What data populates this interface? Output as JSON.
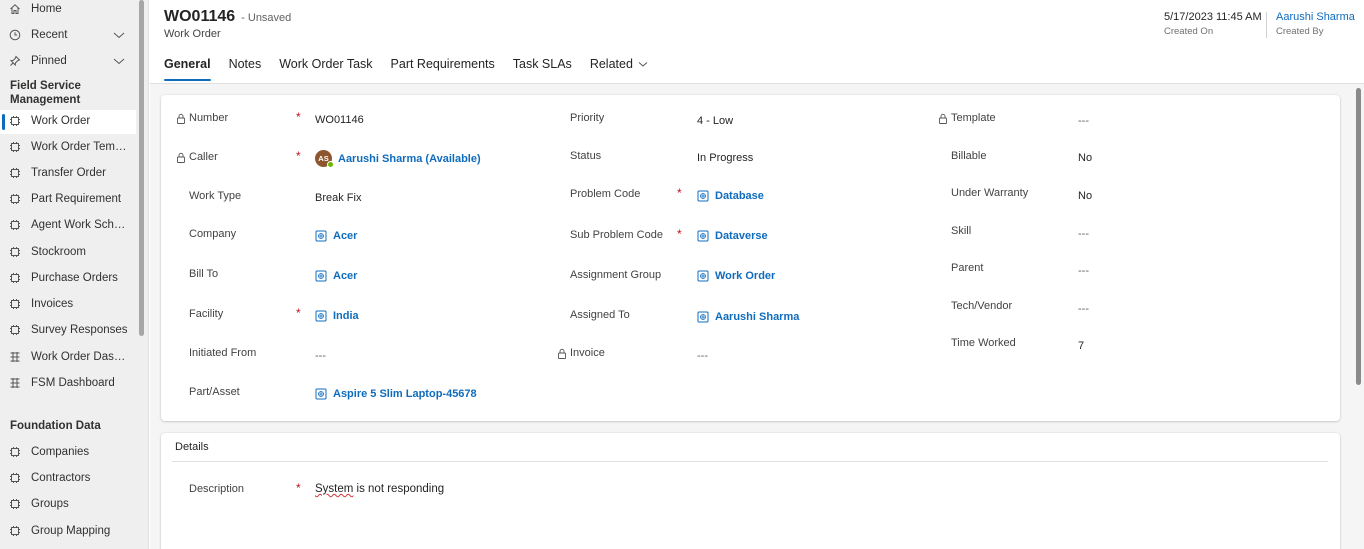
{
  "sidebar": {
    "top_items": [
      {
        "label": "Home",
        "icon": "home-icon"
      },
      {
        "label": "Recent",
        "icon": "clock-icon"
      },
      {
        "label": "Pinned",
        "icon": "pin-icon"
      }
    ],
    "group1_title": "Field Service Management",
    "group1_items": [
      {
        "label": "Work Order"
      },
      {
        "label": "Work Order Templ..."
      },
      {
        "label": "Transfer Order"
      },
      {
        "label": "Part Requirement"
      },
      {
        "label": "Agent Work Sche..."
      },
      {
        "label": "Stockroom"
      },
      {
        "label": "Purchase Orders"
      },
      {
        "label": "Invoices"
      },
      {
        "label": "Survey Responses"
      },
      {
        "label": "Work Order Dash..."
      },
      {
        "label": "FSM Dashboard"
      }
    ],
    "group2_title": "Foundation Data",
    "group2_items": [
      {
        "label": "Companies"
      },
      {
        "label": "Contractors"
      },
      {
        "label": "Groups"
      },
      {
        "label": "Group Mapping"
      }
    ]
  },
  "header": {
    "record_number": "WO01146",
    "status_text": "- Unsaved",
    "entity_name": "Work Order",
    "created_on_value": "5/17/2023 11:45 AM",
    "created_on_label": "Created On",
    "created_by_value": "Aarushi Sharma",
    "created_by_label": "Created By"
  },
  "tabs": [
    "General",
    "Notes",
    "Work Order Task",
    "Part Requirements",
    "Task SLAs",
    "Related"
  ],
  "form": {
    "col1": [
      {
        "label": "Number",
        "value": "WO01146"
      },
      {
        "label": "Caller",
        "value": "Aarushi Sharma (Available)",
        "avatar": "AS"
      },
      {
        "label": "Work Type",
        "value": "Break Fix"
      },
      {
        "label": "Company",
        "value": "Acer"
      },
      {
        "label": "Bill To",
        "value": "Acer"
      },
      {
        "label": "Facility",
        "value": "India"
      },
      {
        "label": "Initiated From",
        "value": "---"
      },
      {
        "label": "Part/Asset",
        "value": "Aspire 5 Slim Laptop-45678"
      }
    ],
    "col2": [
      {
        "label": "Priority",
        "value": "4 - Low"
      },
      {
        "label": "Status",
        "value": "In Progress"
      },
      {
        "label": "Problem Code",
        "value": "Database"
      },
      {
        "label": "Sub Problem Code",
        "value": "Dataverse"
      },
      {
        "label": "Assignment Group",
        "value": "Work Order"
      },
      {
        "label": "Assigned To",
        "value": "Aarushi Sharma"
      },
      {
        "label": "Invoice",
        "value": "---"
      }
    ],
    "col3": [
      {
        "label": "Template",
        "value": "---"
      },
      {
        "label": "Billable",
        "value": "No"
      },
      {
        "label": "Under Warranty",
        "value": "No"
      },
      {
        "label": "Skill",
        "value": "---"
      },
      {
        "label": "Parent",
        "value": "---"
      },
      {
        "label": "Tech/Vendor",
        "value": "---"
      },
      {
        "label": "Time Worked",
        "value": "7"
      }
    ]
  },
  "details": {
    "section_title": "Details",
    "description_label": "Description",
    "description_word1": "System",
    "description_rest": " is not responding"
  },
  "colors": {
    "accent": "#0f6cbd",
    "required": "#c50f1f",
    "sidebar_bg": "#efefef"
  }
}
